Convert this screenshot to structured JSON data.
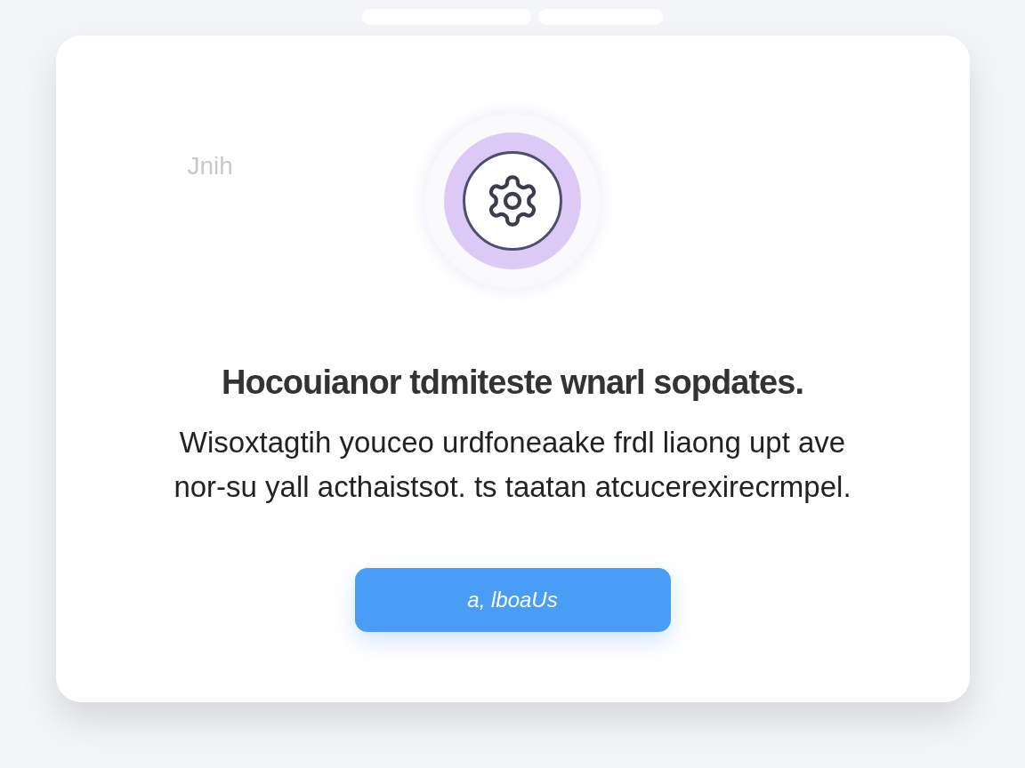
{
  "faint_label": "Jnih",
  "dialog": {
    "title": "Hocouianor tdmiteste wnarl sopdates.",
    "body_lines": [
      "Wisoxtagtih youceo urdfoneaake frdl liaong upt ave",
      "nor-su yall acthaistsot. ts taatan atcucerexirecrmpel."
    ],
    "button": "a, lboaUs"
  }
}
